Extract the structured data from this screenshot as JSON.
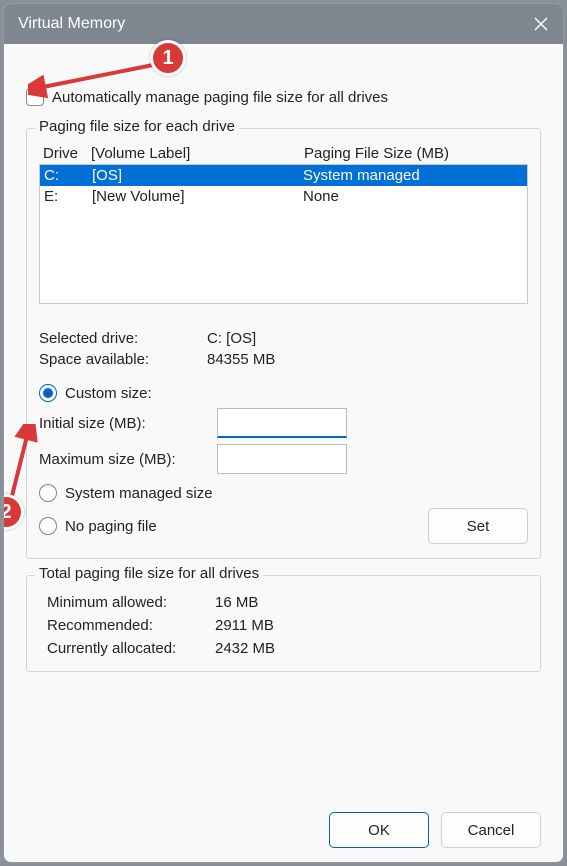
{
  "title": "Virtual Memory",
  "auto_label": "Automatically manage paging file size for all drives",
  "group_drives": {
    "legend": "Paging file size for each drive",
    "header": {
      "drive": "Drive",
      "volume": "[Volume Label]",
      "size": "Paging File Size (MB)"
    },
    "rows": [
      {
        "drive": "C:",
        "volume": "[OS]",
        "size": "System managed",
        "selected": true
      },
      {
        "drive": "E:",
        "volume": "[New Volume]",
        "size": "None",
        "selected": false
      }
    ],
    "selected_drive_label": "Selected drive:",
    "selected_drive_value": "C:  [OS]",
    "space_label": "Space available:",
    "space_value": "84355 MB",
    "radio_custom": "Custom size:",
    "initial_label": "Initial size (MB):",
    "initial_value": "",
    "max_label": "Maximum size (MB):",
    "max_value": "",
    "radio_system": "System managed size",
    "radio_none": "No paging file",
    "set_btn": "Set"
  },
  "group_totals": {
    "legend": "Total paging file size for all drives",
    "min_label": "Minimum allowed:",
    "min_value": "16 MB",
    "rec_label": "Recommended:",
    "rec_value": "2911 MB",
    "cur_label": "Currently allocated:",
    "cur_value": "2432 MB"
  },
  "ok_btn": "OK",
  "cancel_btn": "Cancel",
  "annotations": {
    "a1": "1",
    "a2": "2"
  }
}
